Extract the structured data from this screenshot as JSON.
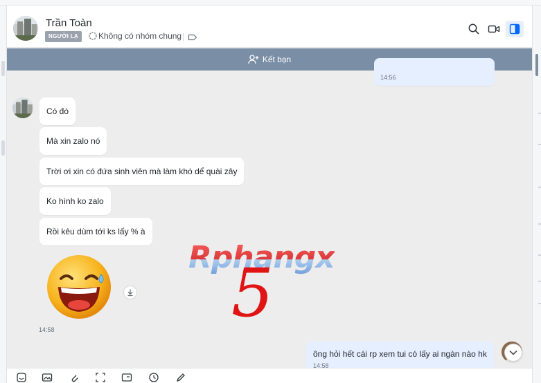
{
  "contact": {
    "name": "Trần Toàn",
    "badge": "NGƯỜI LẠ",
    "common_group": "Không có nhóm chung"
  },
  "friend_bar": {
    "label": "Kết bạn"
  },
  "messages": {
    "top_sent_time": "14:56",
    "received": [
      {
        "text": "Có đó"
      },
      {
        "text": "Mà xin zalo nó"
      },
      {
        "text": "Trời ơi xin có đứa sinh viên mà làm khó dể quài zây"
      },
      {
        "text": "Ko hình ko zalo"
      },
      {
        "text": "Rồi kêu dùm tới ks lấy % à"
      }
    ],
    "received_time": "14:58",
    "sent": {
      "text": "ông hỏi hết cái rp xem tui có lấy ai ngàn nào hk",
      "time": "14:58"
    }
  },
  "watermark": {
    "text": "Rphangx",
    "digit": "5"
  },
  "colors": {
    "friend_bar": "#7a8ea6",
    "badge": "#9aa3ad",
    "sent_bubble": "#e6efff",
    "accent": "#0068ff",
    "background": "#ededed"
  },
  "icons": {
    "header": [
      "search-icon",
      "video-call-icon",
      "side-panel-icon"
    ],
    "toolbar": [
      "sticker-icon",
      "image-icon",
      "attachment-icon",
      "screenshot-icon",
      "business-card-icon",
      "reminder-icon",
      "drawing-icon"
    ]
  }
}
